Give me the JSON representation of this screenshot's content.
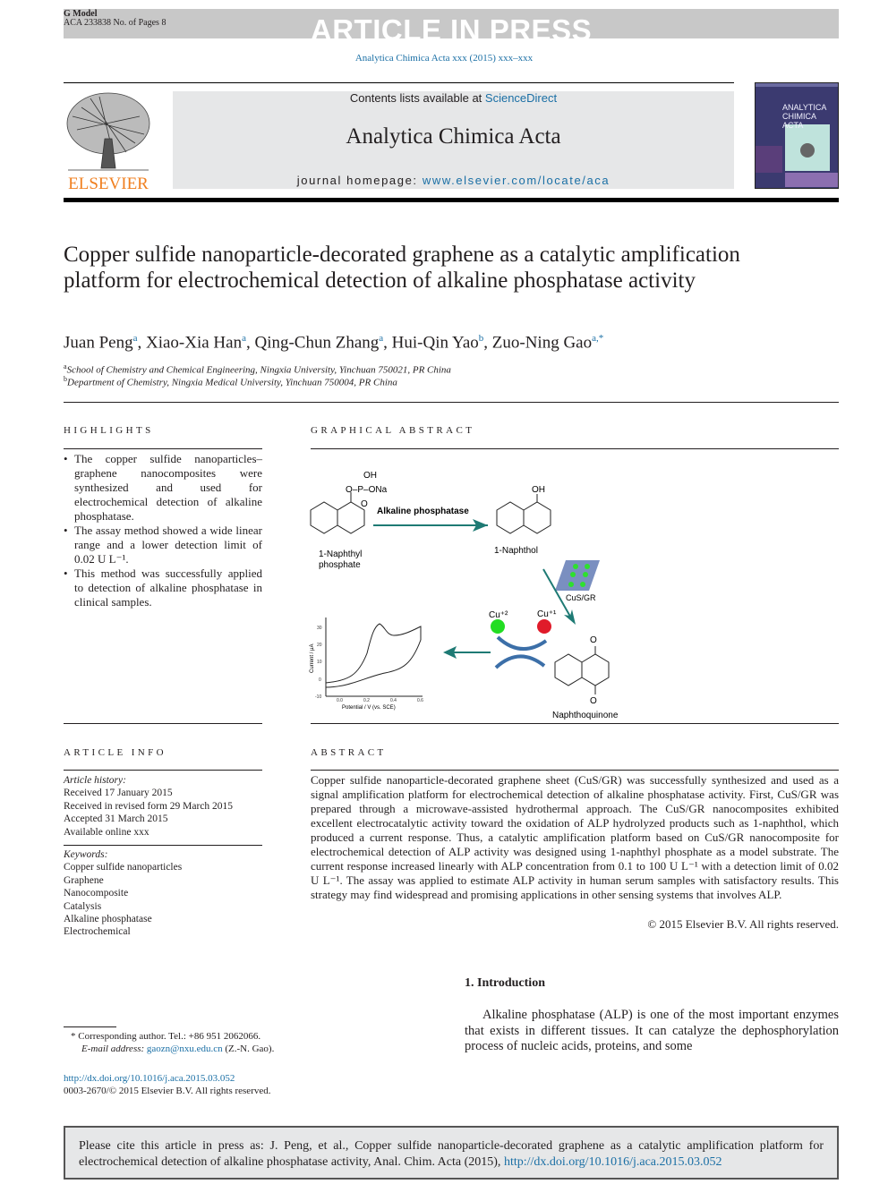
{
  "header": {
    "g_model": "G Model",
    "manuscript": "ACA 233838 No. of Pages 8",
    "banner": "ARTICLE IN PRESS",
    "journal_ref": "Analytica Chimica Acta xxx (2015) xxx–xxx",
    "contents_prefix": "Contents lists available at ",
    "contents_link": "ScienceDirect",
    "journal_title": "Analytica Chimica Acta",
    "homepage_prefix": "journal homepage: ",
    "homepage_link": "www.elsevier.com/locate/aca",
    "publisher_logo": "ELSEVIER",
    "cover_title": "ANALYTICA CHIMICA ACTA"
  },
  "article": {
    "title": "Copper sulfide nanoparticle-decorated graphene as a catalytic amplification platform for electrochemical detection of alkaline phosphatase activity",
    "authors": [
      {
        "name": "Juan Peng",
        "aff": "a"
      },
      {
        "name": "Xiao-Xia Han",
        "aff": "a"
      },
      {
        "name": "Qing-Chun Zhang",
        "aff": "a"
      },
      {
        "name": "Hui-Qin Yao",
        "aff": "b"
      },
      {
        "name": "Zuo-Ning Gao",
        "aff": "a,*"
      }
    ],
    "affiliations": [
      {
        "mark": "a",
        "text": "School of Chemistry and Chemical Engineering, Ningxia University, Yinchuan 750021, PR China"
      },
      {
        "mark": "b",
        "text": "Department of Chemistry, Ningxia Medical University, Yinchuan 750004, PR China"
      }
    ]
  },
  "highlights": {
    "heading": "HIGHLIGHTS",
    "items": [
      "The copper sulfide nanoparticles–graphene nanocomposites were synthesized and used for electrochemical detection of alkaline phosphatase.",
      "The assay method showed a wide linear range and a lower detection limit of 0.02 U L⁻¹.",
      "This method was successfully applied to detection of alkaline phosphatase in clinical samples."
    ]
  },
  "graphical_abstract": {
    "heading": "GRAPHICAL ABSTRACT",
    "labels": {
      "oh_top": "OH",
      "phosphate_group": "O–P–ONa",
      "o_double": "O",
      "enzyme": "Alkaline phosphatase",
      "substrate": "1-Naphthyl",
      "substrate2": "phosphate",
      "oh_product": "OH",
      "product": "1-Naphthol",
      "catalyst": "CuS/GR",
      "cu2": "Cu⁺²",
      "cu1": "Cu⁺¹",
      "quinone_o": "O",
      "quinone": "Naphthoquinone",
      "cv_ylabel": "Current / μA",
      "cv_xlabel": "Potential / V (vs. SCE)",
      "cv_yticks": [
        "30",
        "20",
        "10",
        "0",
        "-10"
      ],
      "cv_xticks": [
        "0.0",
        "0.2",
        "0.4",
        "0.6"
      ]
    },
    "colors": {
      "arrow": "#1e7a74",
      "cu2": "#22dd22",
      "cu1": "#e01b2a",
      "cycle_arrow": "#3c6fa8"
    }
  },
  "article_info": {
    "heading": "ARTICLE INFO",
    "history_label": "Article history:",
    "history": [
      "Received 17 January 2015",
      "Received in revised form 29 March 2015",
      "Accepted 31 March 2015",
      "Available online xxx"
    ],
    "keywords_label": "Keywords:",
    "keywords": [
      "Copper sulfide nanoparticles",
      "Graphene",
      "Nanocomposite",
      "Catalysis",
      "Alkaline phosphatase",
      "Electrochemical"
    ]
  },
  "abstract": {
    "heading": "ABSTRACT",
    "text": "Copper sulfide nanoparticle-decorated graphene sheet (CuS/GR) was successfully synthesized and used as a signal amplification platform for electrochemical detection of alkaline phosphatase activity. First, CuS/GR was prepared through a microwave-assisted hydrothermal approach. The CuS/GR nanocomposites exhibited excellent electrocatalytic activity toward the oxidation of ALP hydrolyzed products such as 1-naphthol, which produced a current response. Thus, a catalytic amplification platform based on CuS/GR nanocomposite for electrochemical detection of ALP activity was designed using 1-naphthyl phosphate as a model substrate. The current response increased linearly with ALP concentration from 0.1 to 100 U L⁻¹ with a detection limit of 0.02 U L⁻¹. The assay was applied to estimate ALP activity in human serum samples with satisfactory results. This strategy may find widespread and promising applications in other sensing systems that involves ALP.",
    "copyright": "© 2015 Elsevier B.V. All rights reserved."
  },
  "introduction": {
    "heading": "1. Introduction",
    "text": "Alkaline phosphatase (ALP) is one of the most important enzymes that exists in different tissues. It can catalyze the dephosphorylation process of nucleic acids, proteins, and some"
  },
  "footnote": {
    "corresponding": "* Corresponding author. Tel.: +86 951 2062066.",
    "email_label": "E-mail address: ",
    "email": "gaozn@nxu.edu.cn",
    "email_suffix": " (Z.-N. Gao).",
    "doi": "http://dx.doi.org/10.1016/j.aca.2015.03.052",
    "issn": "0003-2670/© 2015 Elsevier B.V. All rights reserved."
  },
  "citation": {
    "text": "Please cite this article in press as: J. Peng, et al., Copper sulfide nanoparticle-decorated graphene as a catalytic amplification platform for electrochemical detection of alkaline phosphatase activity, Anal. Chim. Acta (2015), ",
    "link": "http://dx.doi.org/10.1016/j.aca.2015.03.052"
  }
}
